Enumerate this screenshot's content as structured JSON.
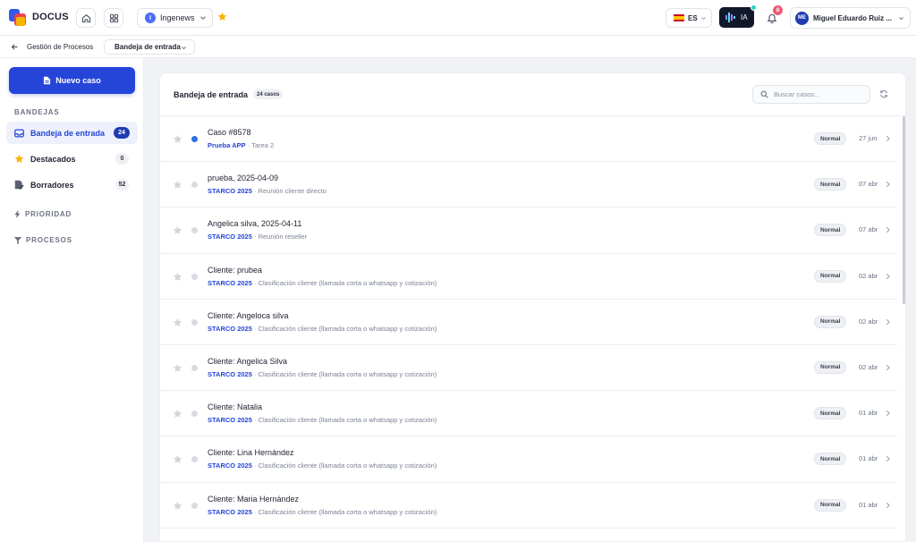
{
  "header": {
    "brand": "DOCUS",
    "org": {
      "initial": "I",
      "name": "Ingenews"
    },
    "language": {
      "code": "ES"
    },
    "ia_label": "IA",
    "notifications_count": "8",
    "user": {
      "initials": "ME",
      "name": "Miguel Eduardo Ruiz ..."
    }
  },
  "breadcrumb": {
    "parent": "Gestión de Procesos",
    "current": "Bandeja de entrada"
  },
  "sidebar": {
    "new_case_label": "Nuevo caso",
    "section_title": "BANDEJAS",
    "items": [
      {
        "label": "Bandeja de entrada",
        "count": "24",
        "icon": "inbox-icon"
      },
      {
        "label": "Destacados",
        "count": "0",
        "icon": "star-icon"
      },
      {
        "label": "Borradores",
        "count": "52",
        "icon": "draft-icon"
      }
    ],
    "groups": [
      {
        "label": "PRIORIDAD",
        "icon": "bolt-icon"
      },
      {
        "label": "PROCESOS",
        "icon": "filter-icon"
      }
    ]
  },
  "panel": {
    "title": "Bandeja de entrada",
    "count_label": "24 casos",
    "search_placeholder": "Buscar casos..."
  },
  "cases": [
    {
      "title": "Caso #8578",
      "project": "Prueba APP",
      "task": "Tarea 2",
      "priority": "Normal",
      "date": "27 jun",
      "unread": true
    },
    {
      "title": "prueba, 2025-04-09",
      "project": "STARCO 2025",
      "task": "Reunión cliente directo",
      "priority": "Normal",
      "date": "07 abr",
      "unread": false
    },
    {
      "title": "Angelica silva, 2025-04-11",
      "project": "STARCO 2025",
      "task": "Reunión reseller",
      "priority": "Normal",
      "date": "07 abr",
      "unread": false
    },
    {
      "title": "Cliente: prubea",
      "project": "STARCO 2025",
      "task": "Clasificación cliente (llamada corta o whatsapp y cotización)",
      "priority": "Normal",
      "date": "02 abr",
      "unread": false
    },
    {
      "title": "Cliente: Angeloca silva",
      "project": "STARCO 2025",
      "task": "Clasificación cliente (llamada corta o whatsapp y cotización)",
      "priority": "Normal",
      "date": "02 abr",
      "unread": false
    },
    {
      "title": "Cliente: Angelica Silva",
      "project": "STARCO 2025",
      "task": "Clasificación cliente (llamada corta o whatsapp y cotización)",
      "priority": "Normal",
      "date": "02 abr",
      "unread": false
    },
    {
      "title": "Cliente: Natalia",
      "project": "STARCO 2025",
      "task": "Clasificación cliente (llamada corta o whatsapp y cotización)",
      "priority": "Normal",
      "date": "01 abr",
      "unread": false
    },
    {
      "title": "Cliente: Lina Hernández",
      "project": "STARCO 2025",
      "task": "Clasificación cliente (llamada corta o whatsapp y cotización)",
      "priority": "Normal",
      "date": "01 abr",
      "unread": false
    },
    {
      "title": "Cliente: Maria Hernández",
      "project": "STARCO 2025",
      "task": "Clasificación cliente (llamada corta o whatsapp y cotización)",
      "priority": "Normal",
      "date": "01 abr",
      "unread": false
    }
  ],
  "colors": {
    "primary": "#2545d9",
    "unread_dot": "#2f6fe4",
    "notification_badge": "#ef5a7a",
    "favorite_star": "#f7b500"
  }
}
